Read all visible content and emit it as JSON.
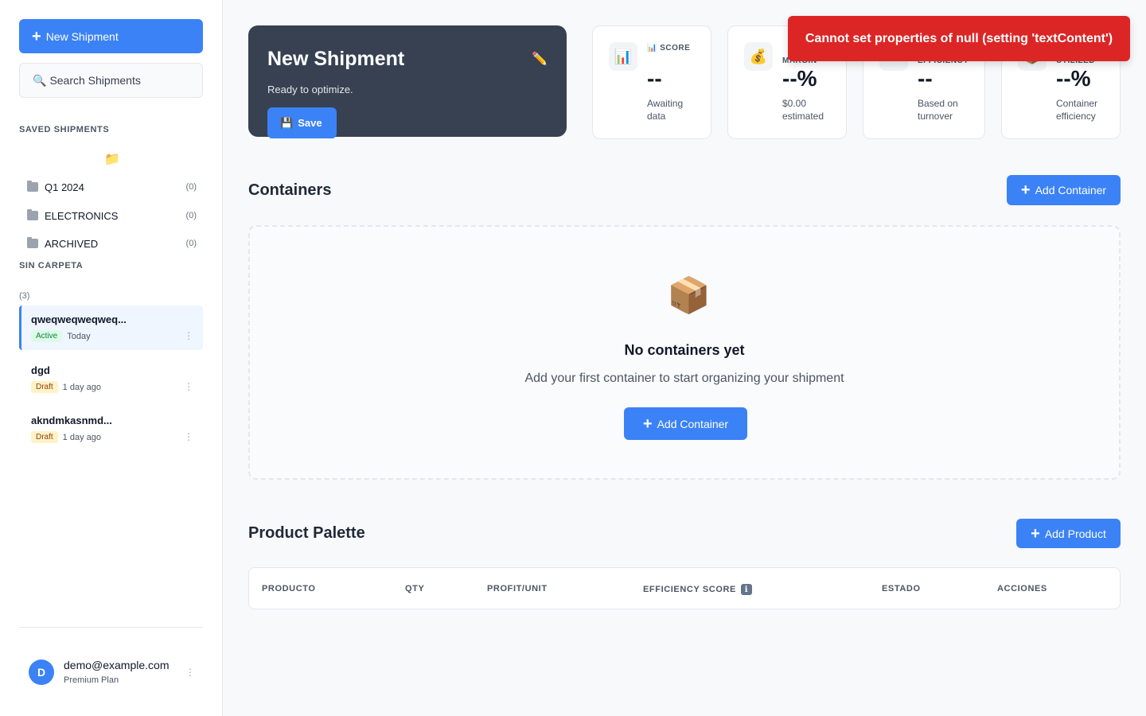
{
  "sidebar": {
    "new_shipment_label": "New Shipment",
    "search_placeholder": "Search Shipments",
    "saved_label": "SAVED SHIPMENTS",
    "folders": [
      {
        "name": "Q1 2024",
        "count": "(0)"
      },
      {
        "name": "ELECTRONICS",
        "count": "(0)"
      },
      {
        "name": "ARCHIVED",
        "count": "(0)"
      }
    ],
    "unfiled_label": "SIN CARPETA",
    "unfiled_count": "(3)",
    "shipments": [
      {
        "name": "qweqweqweqweq...",
        "status": "Active",
        "date": "Today"
      },
      {
        "name": "dgd",
        "status": "Draft",
        "date": "1 day ago"
      },
      {
        "name": "akndmkasnmd...",
        "status": "Draft",
        "date": "1 day ago"
      }
    ],
    "user": {
      "initial": "D",
      "email": "demo@example.com",
      "plan": "Premium Plan"
    }
  },
  "hero": {
    "title": "New Shipment",
    "subtitle": "Ready to optimize.",
    "save_label": "Save"
  },
  "stats": [
    {
      "label": "SCORE",
      "value": "--",
      "note": "Awaiting data",
      "icon": "bar-chart-icon"
    },
    {
      "label": "MARGIN",
      "value": "--%",
      "note": "$0.00 estimated",
      "icon": "money-bag-icon"
    },
    {
      "label": "EFFICIENCY",
      "value": "--",
      "note": "Based on turnover",
      "icon": "lightning-icon"
    },
    {
      "label": "UTILIZED",
      "value": "--%",
      "note": "Container efficiency",
      "icon": "box-icon"
    }
  ],
  "containers": {
    "title": "Containers",
    "add_label": "Add Container",
    "empty_title": "No containers yet",
    "empty_sub": "Add your first container to start organizing your shipment"
  },
  "palette": {
    "title": "Product Palette",
    "add_label": "Add Product",
    "columns": [
      "PRODUCTO",
      "QTY",
      "PROFIT/UNIT",
      "EFFICIENCY SCORE",
      "ESTADO",
      "ACCIONES"
    ]
  },
  "toast": {
    "message": "Cannot set properties of null (setting 'textContent')"
  },
  "colors": {
    "accent": "#3b82f6",
    "hero_bg": "#374151",
    "error": "#dc2626"
  }
}
